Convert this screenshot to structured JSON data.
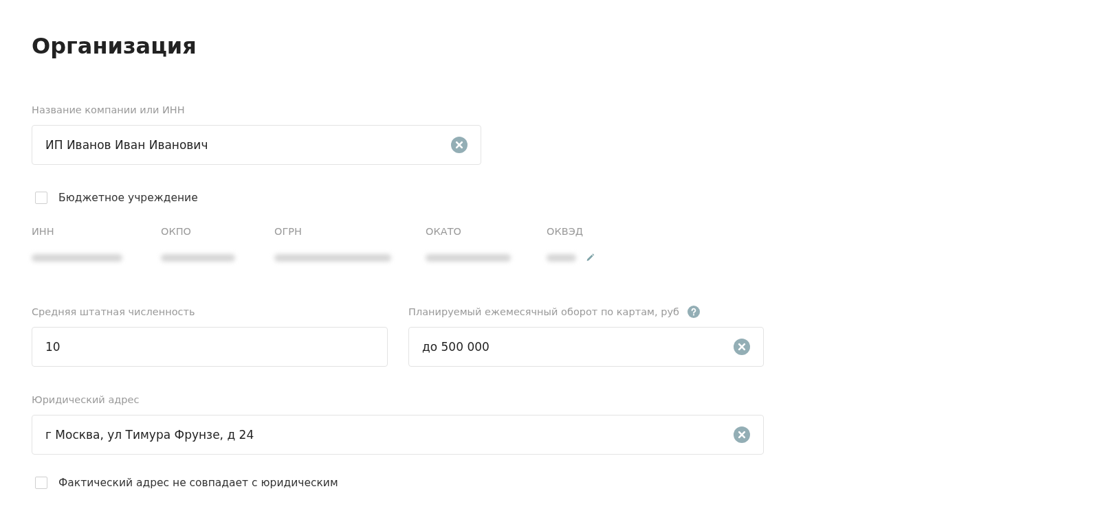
{
  "title": "Организация",
  "company": {
    "label": "Название компании или ИНН",
    "value": "ИП Иванов Иван Иванович",
    "clearable": true
  },
  "budget": {
    "label": "Бюджетное учреждение",
    "checked": false
  },
  "codes": [
    {
      "label": "ИНН",
      "hidden": true
    },
    {
      "label": "ОКПО",
      "hidden": true
    },
    {
      "label": "ОГРН",
      "hidden": true
    },
    {
      "label": "ОКАТО",
      "hidden": true
    },
    {
      "label": "ОКВЭД",
      "hidden": true,
      "editable": true
    }
  ],
  "staff": {
    "label": "Средняя штатная численность",
    "value": "10",
    "clearable": false
  },
  "turnover": {
    "label": "Планируемый ежемесячный оборот по картам, руб",
    "value": "до 500 000",
    "clearable": true,
    "help": true
  },
  "address": {
    "label": "Юридический адрес",
    "value": "г Москва, ул Тимура Фрунзе, д 24",
    "clearable": true
  },
  "actual": {
    "label": "Фактический адрес не совпадает с юридическим",
    "checked": false
  }
}
